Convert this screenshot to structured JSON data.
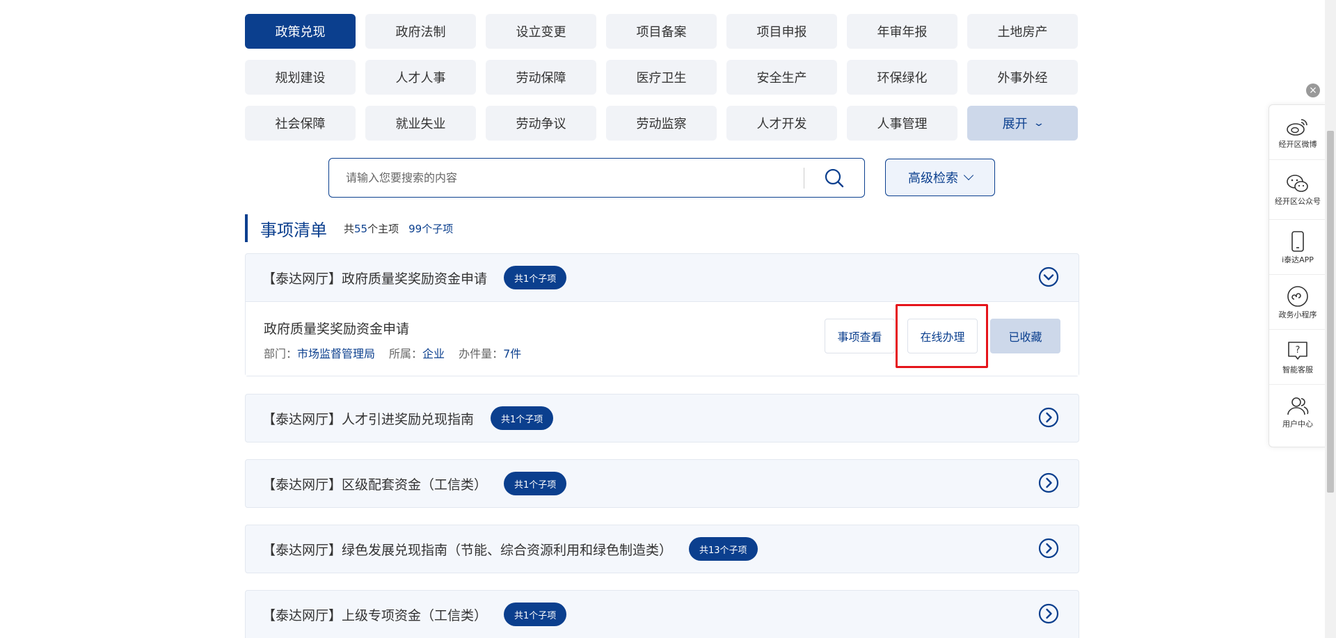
{
  "categories": [
    "政策兑现",
    "政府法制",
    "设立变更",
    "项目备案",
    "项目申报",
    "年审年报",
    "土地房产",
    "规划建设",
    "人才人事",
    "劳动保障",
    "医疗卫生",
    "安全生产",
    "环保绿化",
    "外事外经",
    "社会保障",
    "就业失业",
    "劳动争议",
    "劳动监察",
    "人才开发",
    "人事管理"
  ],
  "active_category": "政策兑现",
  "expand_label": "展开",
  "search": {
    "placeholder": "请输入您要搜索的内容",
    "advanced_label": "高级检索"
  },
  "section": {
    "title": "事项清单",
    "count_prefix": "共",
    "main_count": "55",
    "main_suffix": "个主项",
    "sub_count": "99",
    "sub_suffix": "个子项"
  },
  "items": [
    {
      "title": "【泰达网厅】政府质量奖奖励资金申请",
      "badge": "共1个子项",
      "expanded": true,
      "sub": {
        "title": "政府质量奖奖励资金申请",
        "dept_label": "部门：",
        "dept": "市场监督管理局",
        "owner_label": "所属：",
        "owner": "企业",
        "count_label": "办件量：",
        "count": "7件",
        "view_label": "事项查看",
        "online_label": "在线办理",
        "fav_label": "已收藏"
      }
    },
    {
      "title": "【泰达网厅】人才引进奖励兑现指南",
      "badge": "共1个子项",
      "expanded": false
    },
    {
      "title": "【泰达网厅】区级配套资金（工信类）",
      "badge": "共1个子项",
      "expanded": false
    },
    {
      "title": "【泰达网厅】绿色发展兑现指南（节能、综合资源利用和绿色制造类）",
      "badge": "共13个子项",
      "expanded": false
    },
    {
      "title": "【泰达网厅】上级专项资金（工信类）",
      "badge": "共1个子项",
      "expanded": false
    }
  ],
  "float_panel": [
    {
      "label": "经开区微博",
      "icon": "weibo-icon"
    },
    {
      "label": "经开区公众号",
      "icon": "wechat-icon"
    },
    {
      "label": "i泰达APP",
      "icon": "phone-icon"
    },
    {
      "label": "政务小程序",
      "icon": "mini-program-icon"
    },
    {
      "label": "智能客服",
      "icon": "customer-service-icon"
    },
    {
      "label": "用户中心",
      "icon": "user-center-icon"
    }
  ],
  "colors": {
    "primary": "#0b3f8e",
    "highlight": "#e5141b"
  }
}
